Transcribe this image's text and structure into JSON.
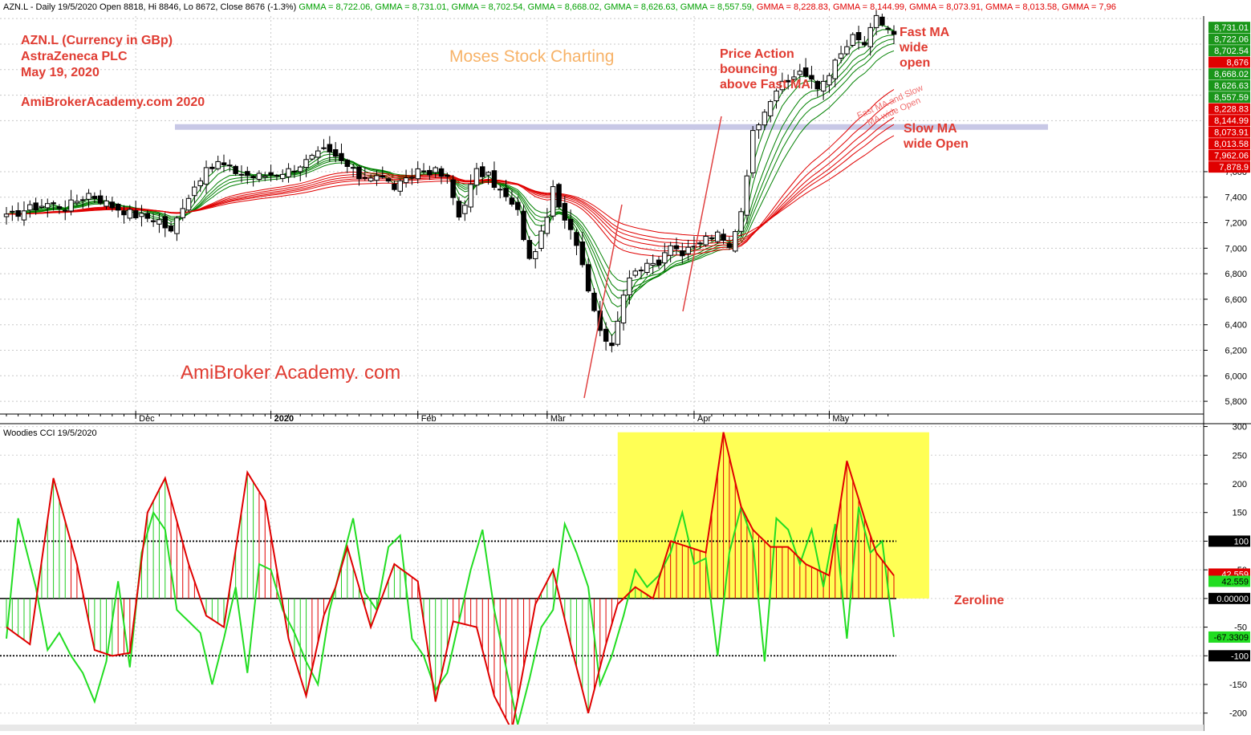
{
  "header": {
    "segments": [
      {
        "text": "AZN.L - Daily 19/5/2020 Open 8818, Hi 8846, Lo 8672, Close 8676 (-1.3%)",
        "color": "#000000"
      },
      {
        "text": " GMMA = 8,722.06,",
        "color": "#00a000"
      },
      {
        "text": " GMMA = 8,731.01,",
        "color": "#00a000"
      },
      {
        "text": " GMMA = 8,702.54,",
        "color": "#00a000"
      },
      {
        "text": " GMMA = 8,668.02,",
        "color": "#00a000"
      },
      {
        "text": " GMMA = 8,626.63,",
        "color": "#00a000"
      },
      {
        "text": " GMMA = 8,557.59,",
        "color": "#00a000"
      },
      {
        "text": " GMMA = 8,228.83,",
        "color": "#e00000"
      },
      {
        "text": " GMMA = 8,144.99,",
        "color": "#e00000"
      },
      {
        "text": " GMMA = 8,073.91,",
        "color": "#e00000"
      },
      {
        "text": " GMMA = 8,013.58,",
        "color": "#e00000"
      },
      {
        "text": " GMMA = 7,96",
        "color": "#e00000"
      }
    ]
  },
  "annotations": {
    "ticker": "AZN.L (Currency in GBp)",
    "company": "AstraZeneca PLC",
    "date": "May 19, 2020",
    "site": "AmiBrokerAcademy.com  2020",
    "watermark": "Moses Stock Charting",
    "brand": "AmiBroker Academy. com",
    "price_action": [
      "Price Action",
      "bouncing",
      "above Fast MA"
    ],
    "fast_ma": [
      "Fast MA",
      "wide",
      "open"
    ],
    "diag": [
      "Fast MA and Slow",
      "MA wide Open"
    ],
    "slow_ma": [
      "Slow MA",
      "wide Open"
    ],
    "zeroline": "Zeroline"
  },
  "lower_title": "Woodies CCI  19/5/2020",
  "colors": {
    "annotation": "#e03c32",
    "fast_ma": "#008000",
    "slow_ma": "#e00000",
    "cci": "#e00000",
    "turbo": "#22dd22",
    "highlight": "#ffff55",
    "hline": "#c8c8e6"
  },
  "chart_data": [
    {
      "type": "candlestick",
      "title": "AZN.L - Daily",
      "ylim": [
        5700,
        8820
      ],
      "y_ticks": [
        5800,
        6000,
        6200,
        6400,
        6600,
        6800,
        7000,
        7200,
        7400,
        7600
      ],
      "x_month_labels": [
        "Dec",
        "2020",
        "Feb",
        "Mar",
        "Apr",
        "May"
      ],
      "x_month_index": [
        22,
        45,
        70,
        92,
        117,
        140
      ],
      "price_tags": [
        {
          "label": "8,731.01",
          "value": 8731,
          "color": "#1a961a"
        },
        {
          "label": "8,722.06",
          "value": 8722,
          "color": "#1a961a"
        },
        {
          "label": "8,702.54",
          "value": 8702,
          "color": "#1a961a"
        },
        {
          "label": "8,676",
          "value": 8676,
          "color": "#e00000"
        },
        {
          "label": "8,668.02",
          "value": 8668,
          "color": "#1a961a"
        },
        {
          "label": "8,626.63",
          "value": 8626,
          "color": "#1a961a"
        },
        {
          "label": "8,557.59",
          "value": 8557,
          "color": "#1a961a"
        },
        {
          "label": "8,228.83",
          "value": 8228,
          "color": "#e00000"
        },
        {
          "label": "8,144.99",
          "value": 8144,
          "color": "#e00000"
        },
        {
          "label": "8,073.91",
          "value": 8073,
          "color": "#e00000"
        },
        {
          "label": "8,013.58",
          "value": 8013,
          "color": "#e00000"
        },
        {
          "label": "7,962.06",
          "value": 7962,
          "color": "#e00000"
        },
        {
          "label": "7,878.9",
          "value": 7878,
          "color": "#e00000"
        }
      ],
      "resistance": 7950,
      "last_close": 8676,
      "last_index": 151,
      "anchors": [
        [
          0,
          7240
        ],
        [
          3,
          7300
        ],
        [
          7,
          7350
        ],
        [
          10,
          7320
        ],
        [
          14,
          7430
        ],
        [
          18,
          7330
        ],
        [
          22,
          7260
        ],
        [
          26,
          7220
        ],
        [
          28,
          7120
        ],
        [
          30,
          7340
        ],
        [
          33,
          7560
        ],
        [
          36,
          7670
        ],
        [
          39,
          7600
        ],
        [
          42,
          7560
        ],
        [
          45,
          7580
        ],
        [
          48,
          7610
        ],
        [
          51,
          7680
        ],
        [
          54,
          7760
        ],
        [
          57,
          7680
        ],
        [
          60,
          7560
        ],
        [
          63,
          7580
        ],
        [
          66,
          7480
        ],
        [
          68,
          7520
        ],
        [
          70,
          7620
        ],
        [
          73,
          7600
        ],
        [
          75,
          7540
        ],
        [
          77,
          7250
        ],
        [
          80,
          7600
        ],
        [
          82,
          7560
        ],
        [
          84,
          7450
        ],
        [
          87,
          7280
        ],
        [
          89,
          6900
        ],
        [
          91,
          7100
        ],
        [
          93,
          7450
        ],
        [
          95,
          7200
        ],
        [
          97,
          7050
        ],
        [
          99,
          6700
        ],
        [
          101,
          6360
        ],
        [
          103,
          6250
        ],
        [
          105,
          6650
        ],
        [
          107,
          6850
        ],
        [
          109,
          6850
        ],
        [
          111,
          6900
        ],
        [
          113,
          7050
        ],
        [
          115,
          6950
        ],
        [
          117,
          7000
        ],
        [
          119,
          7080
        ],
        [
          121,
          7100
        ],
        [
          123,
          7000
        ],
        [
          125,
          7300
        ],
        [
          127,
          7900
        ],
        [
          129,
          8100
        ],
        [
          131,
          8250
        ],
        [
          133,
          8300
        ],
        [
          135,
          8400
        ],
        [
          138,
          8250
        ],
        [
          141,
          8450
        ],
        [
          144,
          8650
        ],
        [
          146,
          8600
        ],
        [
          148,
          8800
        ],
        [
          150,
          8720
        ],
        [
          151,
          8676
        ]
      ],
      "series": [
        {
          "name": "GMMA",
          "periods": [
            3,
            5,
            8,
            10,
            12,
            15
          ],
          "color": "#008000",
          "last": [
            8722.06,
            8731.01,
            8702.54,
            8668.02,
            8626.63,
            8557.59
          ]
        },
        {
          "name": "GMMA",
          "periods": [
            30,
            35,
            40,
            45,
            50,
            60
          ],
          "color": "#e00000",
          "last": [
            8228.83,
            8144.99,
            8073.91,
            8013.58,
            7962.06,
            7878.9
          ]
        }
      ]
    },
    {
      "type": "line",
      "title": "Woodies CCI  19/5/2020",
      "ylim": [
        -220,
        305
      ],
      "y_ticks": [
        300,
        250,
        200,
        150,
        100,
        50,
        0,
        -50,
        -100,
        -150,
        -200
      ],
      "levels": [
        100,
        0,
        -100
      ],
      "tags": [
        {
          "label": "100",
          "value": 100,
          "color": "#000000"
        },
        {
          "label": "42.559",
          "value": 42.559,
          "color": "#e00000"
        },
        {
          "label": "42.559",
          "value": 30,
          "color": "#22dd22"
        },
        {
          "label": "0.00000",
          "value": 0,
          "color": "#000000"
        },
        {
          "label": "-67.3309",
          "value": -67.3309,
          "color": "#22dd22"
        },
        {
          "label": "-100",
          "value": -100,
          "color": "#000000"
        }
      ],
      "series": [
        {
          "name": "CCI",
          "color": "#e00000",
          "x": [
            0,
            4,
            8,
            12,
            15,
            18,
            21,
            24,
            27,
            31,
            34,
            37,
            41,
            44,
            48,
            51,
            54,
            56,
            58,
            62,
            66,
            70,
            73,
            76,
            80,
            83,
            86,
            90,
            93,
            96,
            99,
            102,
            104,
            107,
            110,
            113,
            116,
            119,
            122,
            125,
            127,
            130,
            133,
            136,
            140,
            143,
            146,
            148,
            151
          ],
          "values": [
            -50,
            -80,
            210,
            60,
            -90,
            -100,
            -95,
            150,
            210,
            60,
            -30,
            -50,
            220,
            170,
            -70,
            -170,
            -30,
            20,
            90,
            -50,
            60,
            30,
            -180,
            -40,
            -50,
            -170,
            -230,
            -10,
            50,
            -80,
            -200,
            -80,
            -10,
            20,
            0,
            100,
            90,
            80,
            290,
            160,
            120,
            90,
            90,
            60,
            40,
            240,
            140,
            80,
            40
          ]
        },
        {
          "name": "Turbo CCI",
          "color": "#22dd22",
          "x": [
            0,
            2,
            5,
            7,
            9,
            11,
            13,
            15,
            17,
            19,
            21,
            23,
            25,
            27,
            29,
            31,
            33,
            35,
            37,
            39,
            41,
            43,
            45,
            47,
            49,
            51,
            53,
            55,
            57,
            59,
            61,
            63,
            65,
            67,
            69,
            71,
            73,
            75,
            77,
            79,
            81,
            83,
            85,
            87,
            89,
            91,
            93,
            95,
            97,
            99,
            101,
            103,
            105,
            107,
            109,
            111,
            113,
            115,
            117,
            119,
            121,
            123,
            125,
            127,
            129,
            131,
            133,
            135,
            137,
            139,
            141,
            143,
            145,
            147,
            149,
            151
          ],
          "values": [
            -70,
            140,
            20,
            -90,
            -60,
            -100,
            -130,
            -180,
            -110,
            30,
            -120,
            80,
            150,
            120,
            -20,
            -40,
            -60,
            -150,
            -70,
            20,
            -130,
            60,
            50,
            -20,
            -60,
            -110,
            -150,
            -20,
            60,
            140,
            10,
            -20,
            90,
            110,
            -70,
            -100,
            -160,
            -130,
            -40,
            50,
            120,
            -20,
            -120,
            -220,
            -140,
            -50,
            -20,
            130,
            80,
            20,
            -150,
            -100,
            -30,
            50,
            20,
            40,
            80,
            150,
            60,
            70,
            -100,
            80,
            160,
            100,
            -110,
            140,
            120,
            60,
            120,
            20,
            130,
            -70,
            160,
            80,
            100,
            -67
          ]
        }
      ],
      "highlight": {
        "x": [
          104,
          157
        ],
        "y": [
          0,
          290
        ]
      }
    }
  ]
}
